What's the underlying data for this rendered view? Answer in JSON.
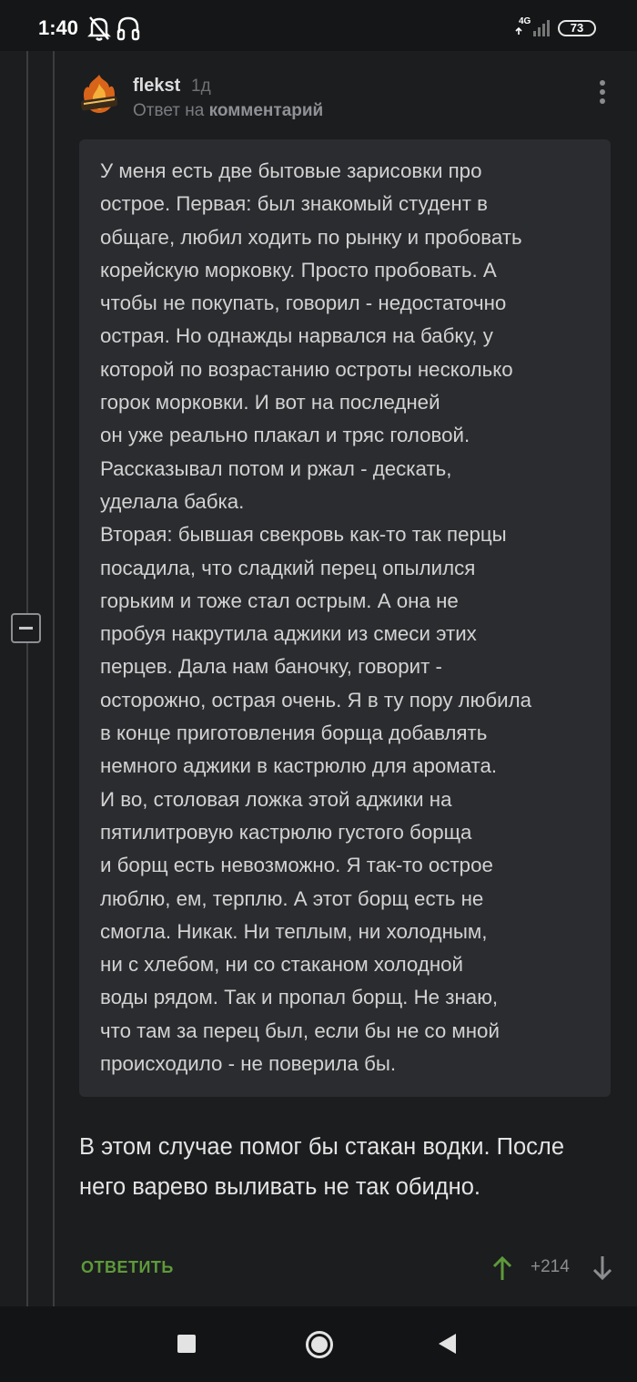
{
  "status_bar": {
    "time": "1:40",
    "network": "4G",
    "battery": "73",
    "icons": [
      "bell-off-icon",
      "headset-icon",
      "signal-icon",
      "battery-icon"
    ]
  },
  "comment": {
    "author": "flekst",
    "time_ago": "1д",
    "reply_prefix": "Ответ на ",
    "reply_link": "комментарий",
    "quote": "У меня есть две бытовые зарисовки про\nострое. Первая: был знакомый студент в\nобщаге, любил ходить по рынку и пробовать\nкорейскую морковку. Просто пробовать. А\nчтобы не покупать, говорил - недостаточно\nострая. Но однажды нарвался на бабку, у\nкоторой по возрастанию остроты несколько\nгорок морковки. И вот на последней\nон уже реально плакал и тряс головой.\nРассказывал потом и ржал - дескать,\nуделала бабка.\nВторая: бывшая свекровь как-то так перцы\nпосадила, что сладкий перец опылился\nгорьким и тоже стал острым. А она не\nпробуя накрутила аджики из смеси этих\nперцев. Дала нам баночку, говорит -\nосторожно, острая очень. Я в ту пору любила\nв конце приготовления борща добавлять\nнемного аджики в кастрюлю для аромата.\nИ во, столовая ложка этой аджики на\nпятилитровую кастрюлю густого борща\nи борщ есть невозможно. Я так-то острое\nлюблю, ем, терплю. А этот борщ есть не\nсмогла. Никак. Ни теплым, ни холодным,\nни с хлебом, ни со стаканом холодной\nводы рядом. Так и пропал борщ. Не знаю,\nчто там за перец был, если бы не со мной\nпроисходило - не поверила бы.",
    "text": "В этом случае помог бы стакан водки. После него варево выливать не так обидно.",
    "reply_button": "ОТВЕТИТЬ",
    "rating": "+214",
    "colors": {
      "accent": "#5d9a3a",
      "background": "#1c1d1f",
      "quote_bg": "#2b2c2f"
    }
  },
  "nav_bar": {
    "icons": [
      "recents-square-icon",
      "home-circle-icon",
      "back-triangle-icon"
    ]
  }
}
